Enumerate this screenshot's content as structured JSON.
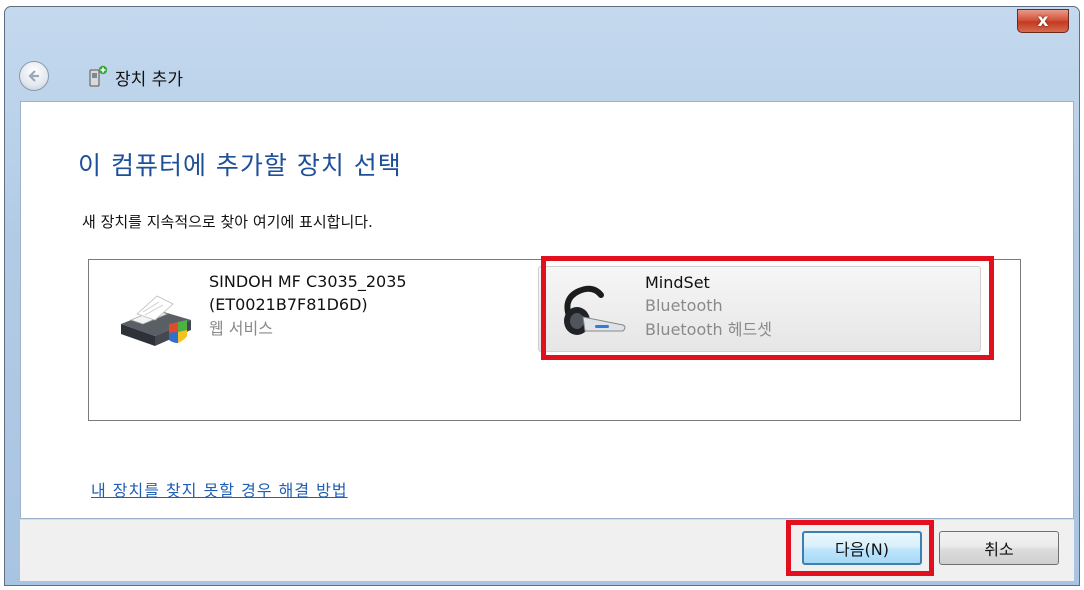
{
  "window": {
    "close_label": "x"
  },
  "header": {
    "title": "장치 추가"
  },
  "main": {
    "heading": "이 컴퓨터에 추가할 장치 선택",
    "subtitle": "새 장치를 지속적으로 찾아 여기에 표시합니다."
  },
  "devices": [
    {
      "name_line1": "SINDOH MF C3035_2035",
      "name_line2": "(ET0021B7F81D6D)",
      "type": "웹 서비스",
      "icon": "printer-icon"
    },
    {
      "name": "MindSet",
      "connection": "Bluetooth",
      "type": "Bluetooth 헤드셋",
      "icon": "headset-icon"
    }
  ],
  "help_link": "내 장치를 찾지 못할 경우 해결 방법",
  "footer": {
    "next_label": "다음(N)",
    "cancel_label": "취소"
  },
  "colors": {
    "heading": "#1e4f9a",
    "link": "#1f5fb4",
    "highlight": "#e2101f"
  }
}
